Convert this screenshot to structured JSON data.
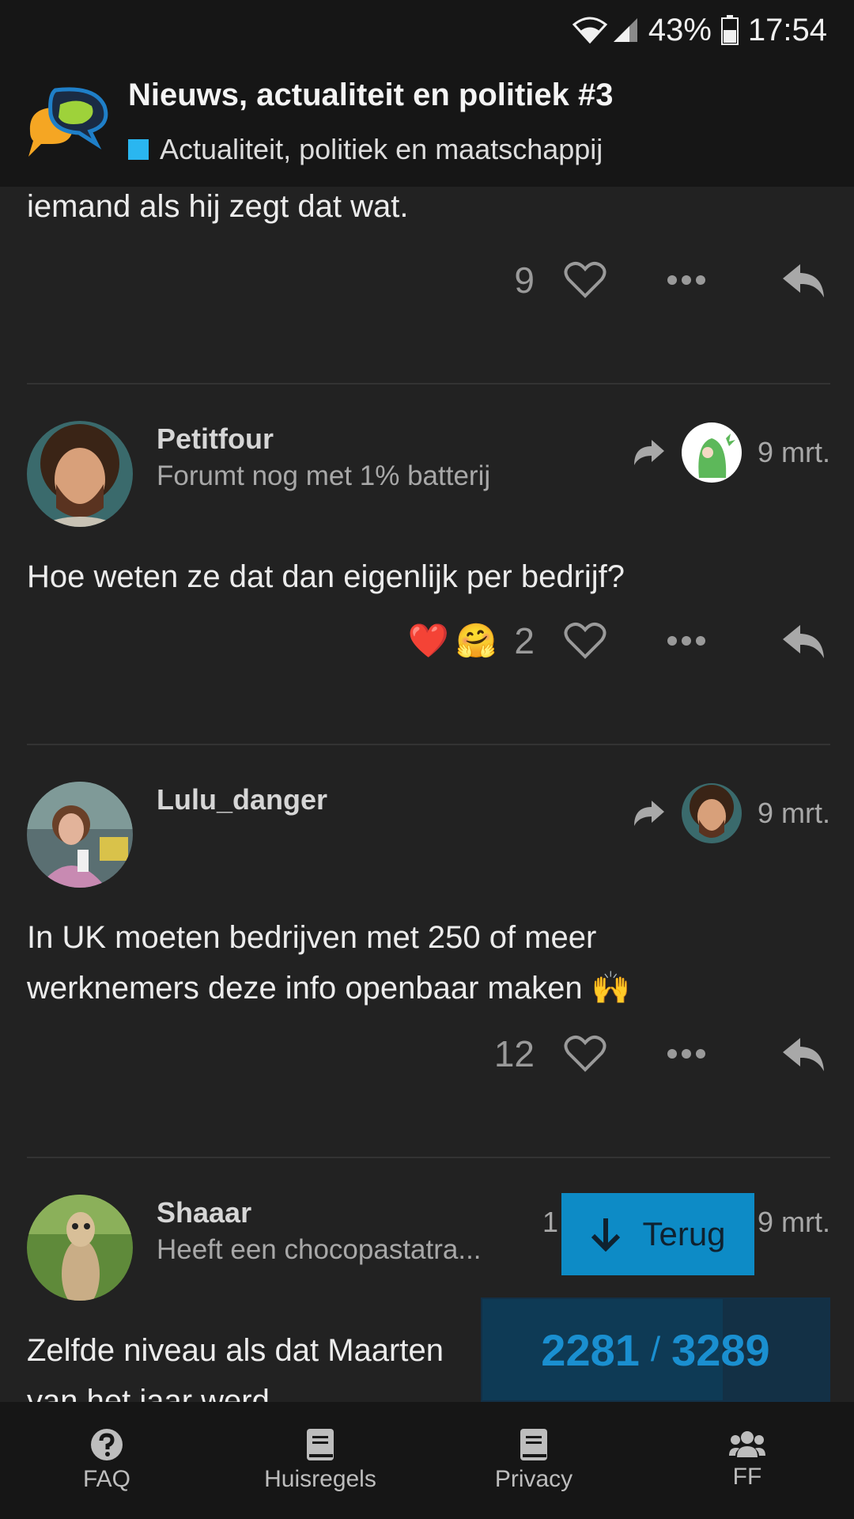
{
  "statusbar": {
    "battery": "43%",
    "time": "17:54"
  },
  "header": {
    "title": "Nieuws, actualiteit en politiek #3",
    "category": "Actualiteit, politiek en maatschappij",
    "category_color": "#2ab6f0"
  },
  "posts": [
    {
      "text": "iemand als hij zegt dat wat.",
      "like_count": "9"
    },
    {
      "username": "Petitfour",
      "user_title": "Forumt nog met 1% batterij",
      "date": "9 mrt.",
      "text": "Hoe weten ze dat dan eigenlijk per bedrijf?",
      "reactions": [
        "❤️",
        "🤗"
      ],
      "like_count": "2"
    },
    {
      "username": "Lulu_danger",
      "date": "9 mrt.",
      "text_line1": "In UK moeten bedrijven met 250 of meer",
      "text_line2": "werknemers deze info openbaar maken 🙌",
      "like_count": "12"
    },
    {
      "username": "Shaaar",
      "user_title": "Heeft een chocopastatra...",
      "reply_count_partial": "1",
      "date": "9 mrt.",
      "text_line1": "Zelfde niveau als dat Maarten",
      "text_line2": "van het jaar werd"
    }
  ],
  "jump_back": {
    "label": "Terug"
  },
  "timeline": {
    "current": "2281",
    "separator": "/",
    "total": "3289",
    "progress_fraction": 0.6935
  },
  "bottom_nav": [
    {
      "label": "FAQ",
      "icon": "question-circle-icon"
    },
    {
      "label": "Huisregels",
      "icon": "book-icon"
    },
    {
      "label": "Privacy",
      "icon": "book-icon"
    },
    {
      "label": "FF",
      "icon": "users-icon"
    }
  ]
}
